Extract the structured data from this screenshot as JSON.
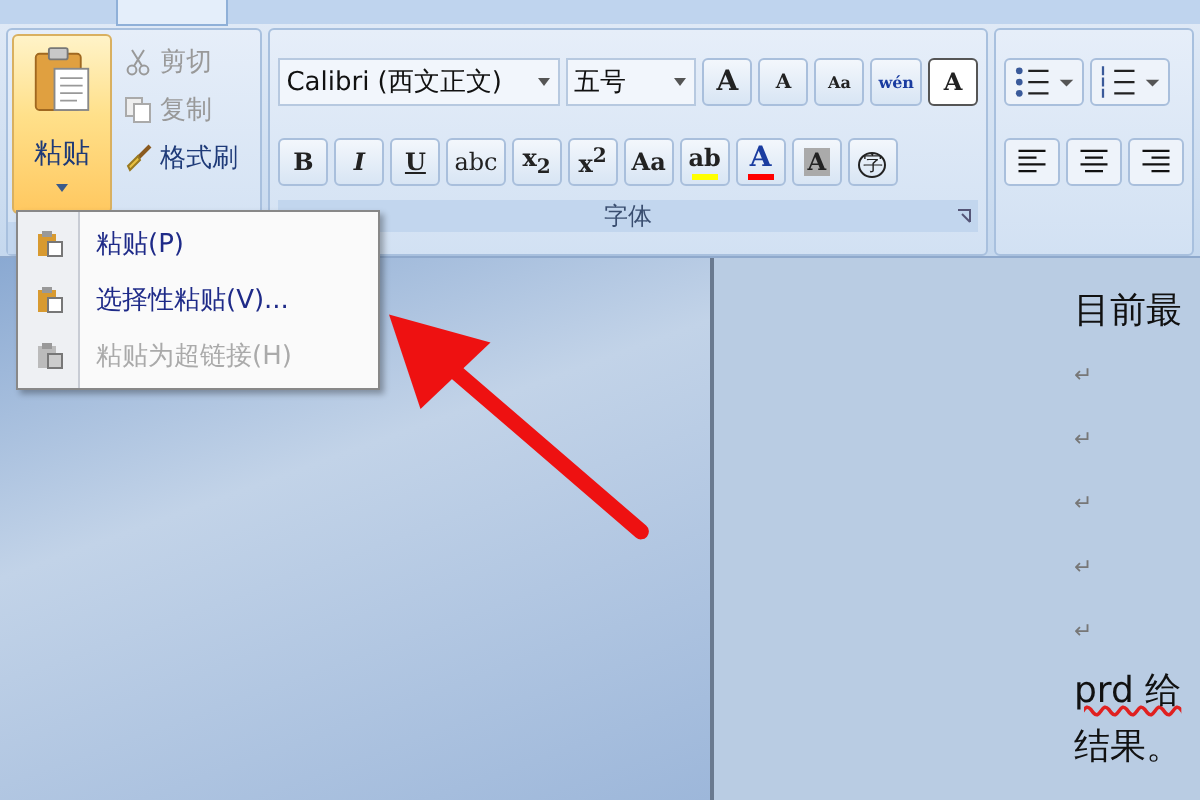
{
  "clipboard": {
    "paste_label": "粘贴",
    "small_buttons": [
      {
        "label": "剪切",
        "disabled": true,
        "kind": "cut"
      },
      {
        "label": "复制",
        "disabled": true,
        "kind": "copy"
      },
      {
        "label": "格式刷",
        "disabled": false,
        "kind": "brush"
      }
    ]
  },
  "font": {
    "name": "Calibri (西文正文)",
    "size": "五号",
    "group_label": "字体",
    "row1": [
      {
        "text": "A",
        "kind": "grow"
      },
      {
        "text": "A",
        "kind": "shrink"
      },
      {
        "text": "Aa",
        "kind": "clear"
      },
      {
        "text": "wén",
        "kind": "phonetic"
      },
      {
        "text": "A",
        "kind": "border"
      }
    ],
    "row2": [
      {
        "text": "B",
        "kind": "bold"
      },
      {
        "text": "I",
        "kind": "italic"
      },
      {
        "text": "U",
        "kind": "underline"
      },
      {
        "text": "abc",
        "kind": "strike"
      },
      {
        "text": "x$_{2}$",
        "kind": "plain"
      },
      {
        "text": "x$^{2}$",
        "kind": "plain"
      },
      {
        "text": "Aa",
        "kind": "case"
      },
      {
        "text": "ab",
        "kind": "highlight",
        "color": "#ffff00"
      },
      {
        "text": "A",
        "kind": "fontcolor",
        "color": "#ff0000"
      },
      {
        "text": "A",
        "kind": "shade"
      },
      {
        "text": "字",
        "kind": "circle"
      }
    ]
  },
  "paste_menu": [
    {
      "label": "粘贴(P)",
      "disabled": false
    },
    {
      "label": "选择性粘贴(V)...",
      "disabled": false
    },
    {
      "label": "粘贴为超链接(H)",
      "disabled": true
    }
  ],
  "document": [
    {
      "kind": "text",
      "text": "目前最",
      "misspelled": false
    },
    {
      "kind": "mark",
      "text": "↵",
      "misspelled": false
    },
    {
      "kind": "mark",
      "text": "↵",
      "misspelled": false
    },
    {
      "kind": "mark",
      "text": "↵",
      "misspelled": false
    },
    {
      "kind": "mark",
      "text": "↵",
      "misspelled": false
    },
    {
      "kind": "mark",
      "text": "↵",
      "misspelled": false
    },
    {
      "kind": "text",
      "text": "prd 给",
      "misspelled": true
    },
    {
      "kind": "text",
      "text": "结果。",
      "misspelled": false
    }
  ]
}
